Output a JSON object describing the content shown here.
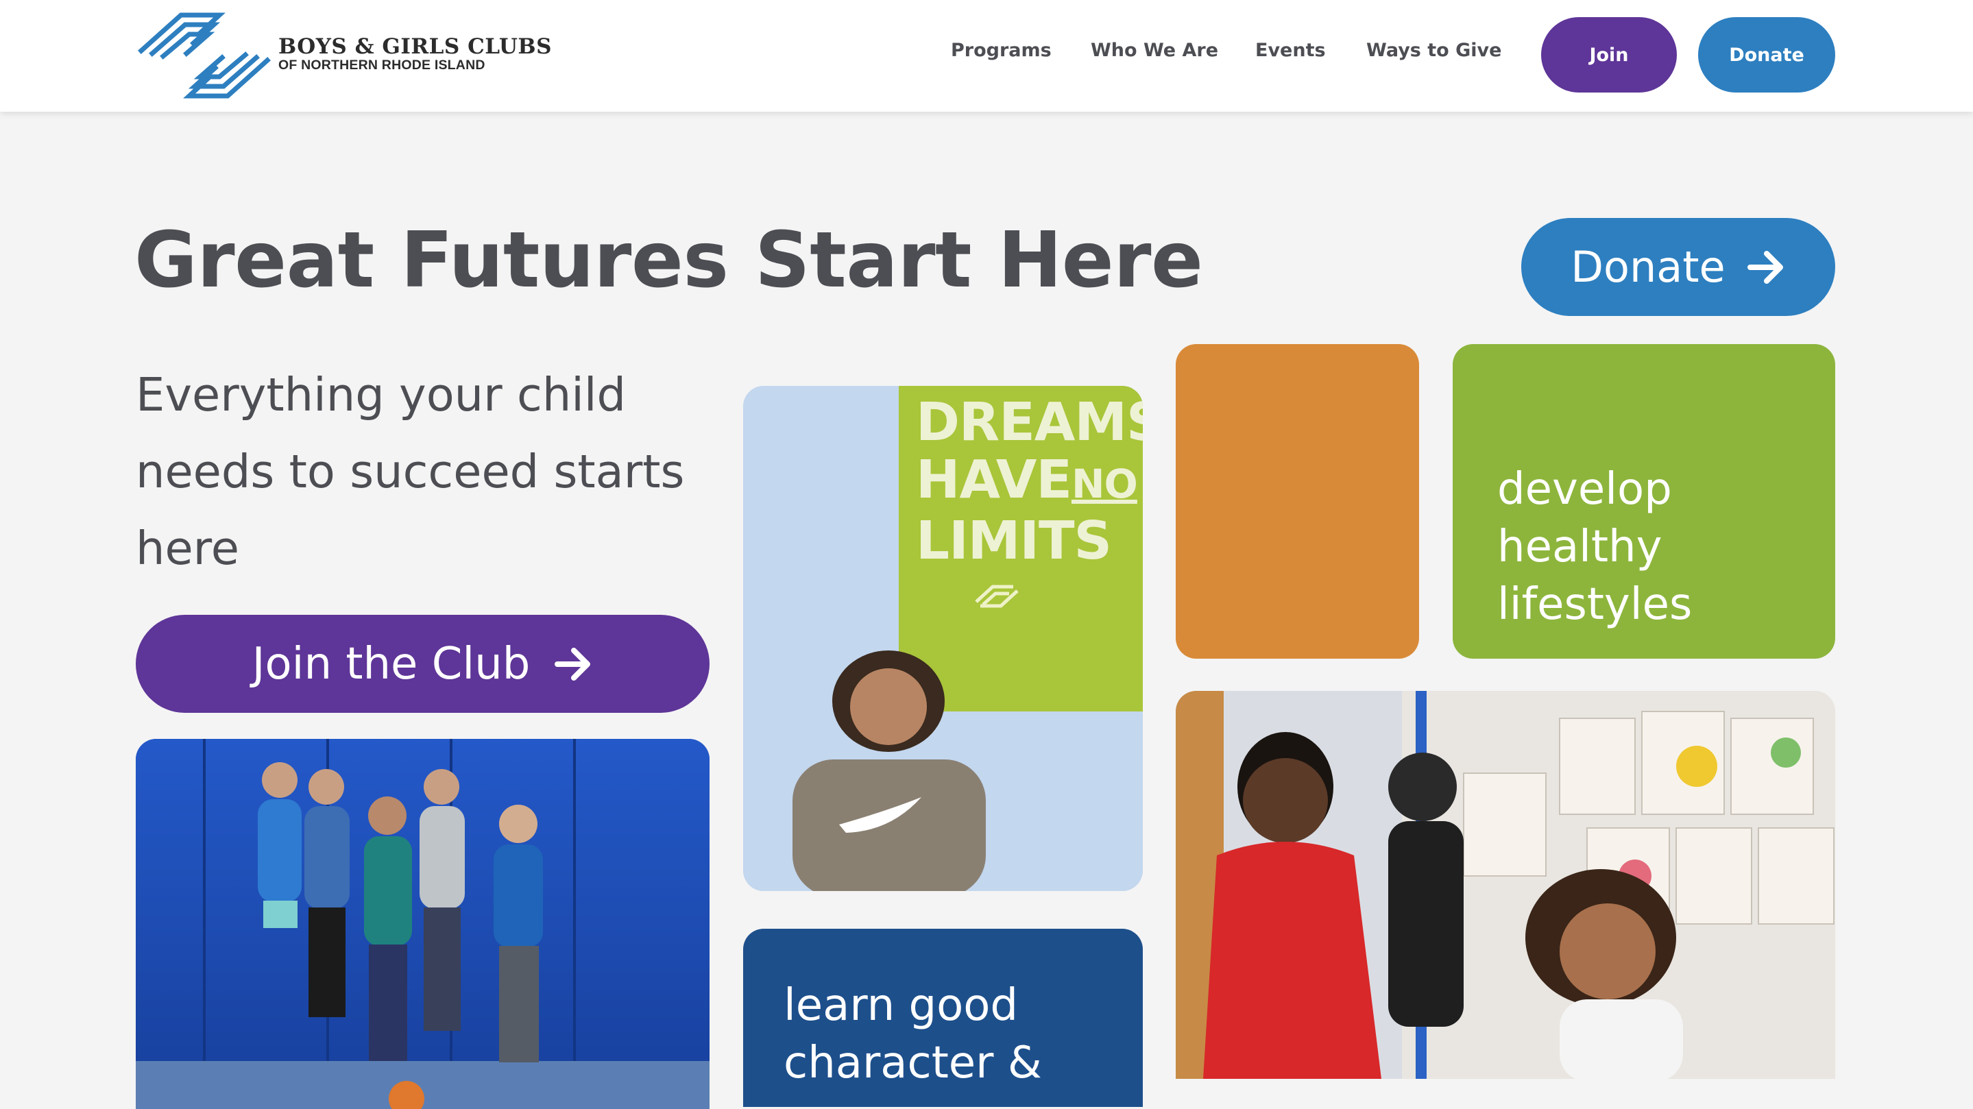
{
  "brand": {
    "name_line1": "BOYS & GIRLS CLUBS",
    "name_line2": "OF NORTHERN RHODE ISLAND",
    "logo_icon": "clasped-hands-logo-icon",
    "color_blue": "#2d7fc0"
  },
  "nav": {
    "items": [
      {
        "label": "Programs"
      },
      {
        "label": "Who We Are"
      },
      {
        "label": "Events"
      },
      {
        "label": "Ways to Give"
      }
    ],
    "join_label": "Join",
    "donate_label": "Donate",
    "join_color": "#5e3598",
    "donate_color": "#2d7fc0"
  },
  "hero": {
    "title": "Great Futures Start Here",
    "donate_label": "Donate",
    "subtitle": "Everything your child needs to succeed starts here",
    "join_club_label": "Join the Club",
    "arrow_icon": "arrow-right-icon"
  },
  "tiles": {
    "poster_text": [
      "DREAMS",
      "HAVE",
      "NO",
      "LIMITS"
    ],
    "healthy_text": [
      "develop",
      "healthy",
      "lifestyles"
    ],
    "character_text": [
      "learn good",
      "character &"
    ],
    "colors": {
      "orange": "#d98a38",
      "green": "#8db53c",
      "navy": "#1d4f8b",
      "purple": "#5e3598"
    }
  }
}
